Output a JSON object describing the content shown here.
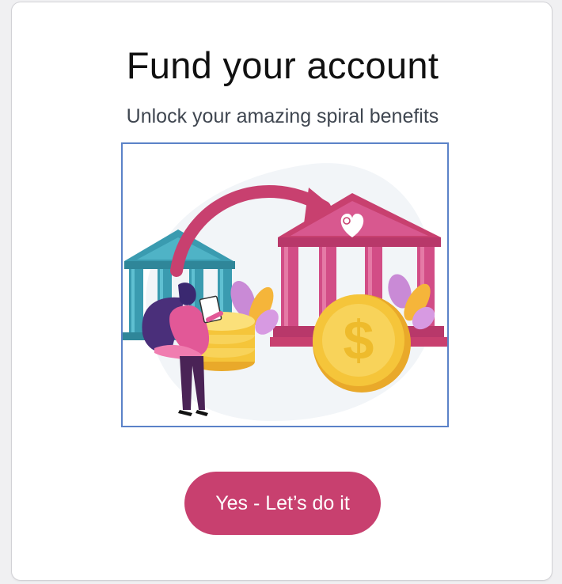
{
  "header": {
    "title": "Fund your account",
    "subtitle": "Unlock your amazing spiral benefits"
  },
  "illustration": {
    "icons": [
      "bank-building-icon",
      "bank-building-icon",
      "heart-spiral-logo-icon",
      "dollar-coin-icon",
      "coin-stack-icon",
      "transfer-arrow-icon"
    ]
  },
  "actions": {
    "confirm_label": "Yes - Let’s do it"
  },
  "colors": {
    "brand_pink": "#c8406f",
    "bank_teal": "#3a9bb0",
    "bank_pink": "#d24d86",
    "coin_gold": "#f5c53a",
    "illustration_border": "#5b82c8"
  }
}
